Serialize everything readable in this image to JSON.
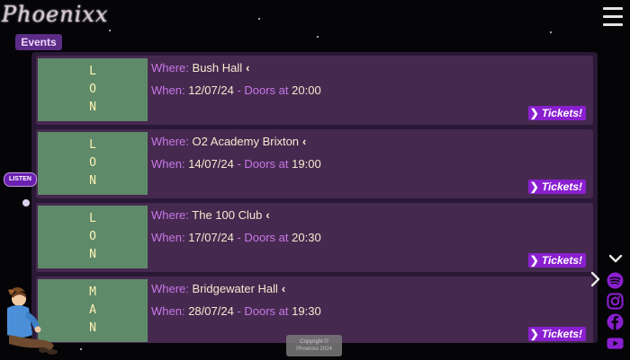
{
  "brand": {
    "logo_text": "Phoenixx"
  },
  "nav": {
    "events_tab": "Events",
    "menu_icon": "hamburger-icon"
  },
  "listen_label": "LISTEN",
  "events": [
    {
      "city_letters": [
        "L",
        "O",
        "N"
      ],
      "where_label": "Where:",
      "venue": "Bush Hall",
      "when_label": "When:",
      "date": "12/07/24",
      "doors_label": "- Doors at",
      "time": "20:00",
      "tickets_label": "Tickets!"
    },
    {
      "city_letters": [
        "L",
        "O",
        "N"
      ],
      "where_label": "Where:",
      "venue": "O2 Academy Brixton",
      "when_label": "When:",
      "date": "14/07/24",
      "doors_label": "- Doors at",
      "time": "19:00",
      "tickets_label": "Tickets!"
    },
    {
      "city_letters": [
        "L",
        "O",
        "N"
      ],
      "where_label": "Where:",
      "venue": "The 100 Club",
      "when_label": "When:",
      "date": "17/07/24",
      "doors_label": "- Doors at",
      "time": "20:30",
      "tickets_label": "Tickets!"
    },
    {
      "city_letters": [
        "M",
        "A",
        "N"
      ],
      "where_label": "Where:",
      "venue": "Bridgewater Hall",
      "when_label": "When:",
      "date": "28/07/24",
      "doors_label": "- Doors at",
      "time": "19:30",
      "tickets_label": "Tickets!"
    }
  ],
  "footer": {
    "copyright_line1": "Copyright ©",
    "copyright_line2": "Phoenixx 2024"
  },
  "social": [
    "spotify-icon",
    "instagram-icon",
    "facebook-icon",
    "youtube-icon"
  ],
  "colors": {
    "background": "#050407",
    "card": "#46294f",
    "city_block": "#5e8a6a",
    "label_purple": "#c678e8",
    "tickets_button": "#8a1fd0"
  }
}
